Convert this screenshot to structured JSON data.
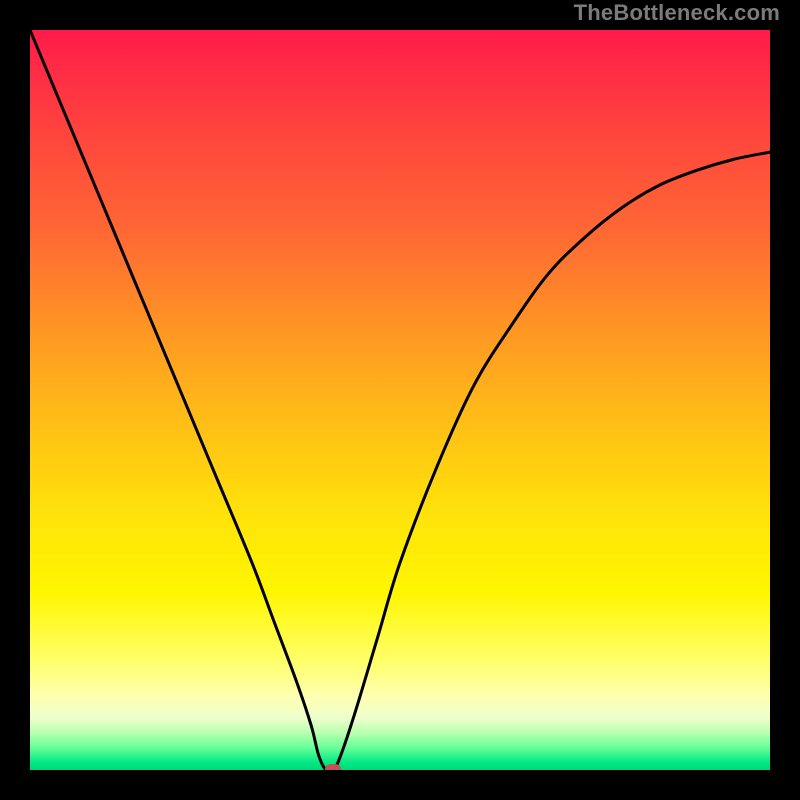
{
  "watermark": "TheBottleneck.com",
  "chart_data": {
    "type": "line",
    "title": "",
    "xlabel": "",
    "ylabel": "",
    "xlim": [
      0,
      100
    ],
    "ylim": [
      0,
      100
    ],
    "series": [
      {
        "name": "curve",
        "x": [
          0,
          5,
          10,
          15,
          20,
          25,
          30,
          33,
          36,
          38,
          39,
          40,
          41,
          42,
          44,
          47,
          50,
          55,
          60,
          65,
          70,
          75,
          80,
          85,
          90,
          95,
          100
        ],
        "values": [
          100,
          88,
          76,
          64,
          52,
          40,
          28,
          20,
          12,
          6,
          2,
          0,
          0,
          2,
          8,
          18,
          28,
          41,
          52,
          60,
          67,
          72,
          76,
          79,
          81,
          82.5,
          83.5
        ]
      }
    ],
    "marker": {
      "x": 41,
      "y": 0
    },
    "gradient_colors": {
      "top": "#ff1b4a",
      "mid": "#ffe40a",
      "bottom": "#00d87a"
    }
  }
}
